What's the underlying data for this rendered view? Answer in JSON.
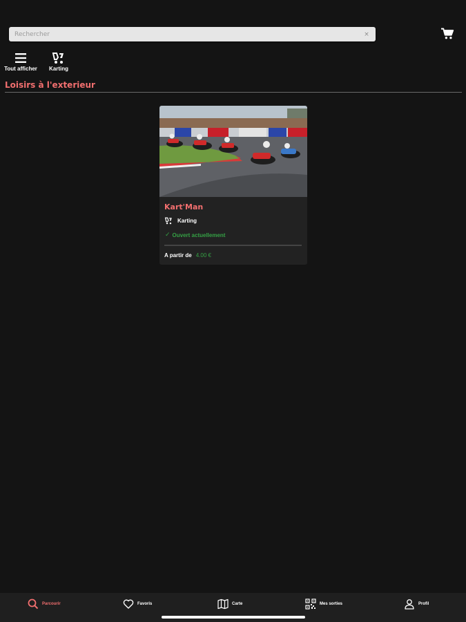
{
  "search": {
    "placeholder": "Rechercher",
    "clear_symbol": "×"
  },
  "header": {
    "cart_icon": "cart-icon"
  },
  "categories": [
    {
      "label": "Tout afficher",
      "icon": "list-icon"
    },
    {
      "label": "Karting",
      "icon": "karting-icon"
    }
  ],
  "section": {
    "title": "Loisirs à l'exterieur"
  },
  "card": {
    "title": "Kart'Man",
    "type_label": "Karting",
    "status": "Ouvert actuellement",
    "price_label": "A partir de",
    "price_value": "4.00 €",
    "image": "go-kart-race-photo"
  },
  "nav": [
    {
      "label": "Parcourir",
      "icon": "search-icon",
      "active": true
    },
    {
      "label": "Favoris",
      "icon": "heart-icon",
      "active": false
    },
    {
      "label": "Carte",
      "icon": "map-icon",
      "active": false
    },
    {
      "label": "Mes sorties",
      "icon": "qr-code-icon",
      "active": false
    },
    {
      "label": "Profil",
      "icon": "user-icon",
      "active": false
    }
  ],
  "colors": {
    "accent": "#f26f6f",
    "success": "#35a145",
    "background": "#141414",
    "card": "#222222"
  }
}
